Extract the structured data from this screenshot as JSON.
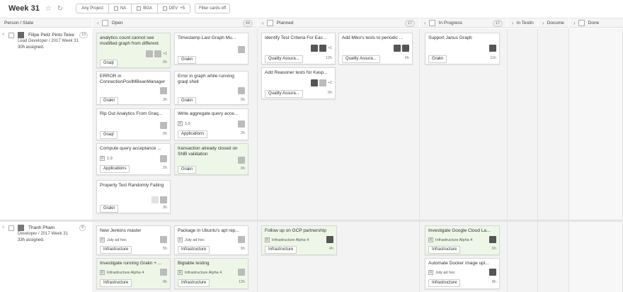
{
  "board": {
    "title": "Week 31",
    "filters": [
      "Any Project",
      "NA",
      "BGA",
      "DEV",
      "+5"
    ],
    "filter_off_label": "Filter cards off"
  },
  "columns": [
    {
      "label": "Person / State",
      "count": ""
    },
    {
      "label": "Open",
      "count": "44"
    },
    {
      "label": "Planned",
      "count": "17"
    },
    {
      "label": "In Progress",
      "count": "17"
    },
    {
      "label": "In Testin",
      "count": ""
    },
    {
      "label": "Docume",
      "count": ""
    },
    {
      "label": "Done",
      "count": ""
    }
  ],
  "people": [
    {
      "name": "Filipe Peliz Pinto Teixe",
      "count": "13",
      "role": "Lead Developer / 2017 Week 31",
      "assigned": "30h assigned."
    },
    {
      "name": "Thanh Pham",
      "count": "8",
      "role": "Developer / 2017 Week 31",
      "assigned": "33h assigned."
    }
  ],
  "cards": {
    "c1": {
      "title": "analytics count cannot see modified graph from different",
      "tag": "Graql",
      "hrs": "0h",
      "extra": "+1"
    },
    "c2": {
      "title": "Timestamp Last Graph Mu...",
      "tag": "Grakn",
      "hrs": "0h"
    },
    "c3": {
      "title": "ERROR in ConnectionPoolMBeanManager",
      "tag": "Grakn",
      "hrs": "3h"
    },
    "c4": {
      "title": "Error in graph while running graql shell",
      "tag": "Grakn",
      "hrs": "0h"
    },
    "c5": {
      "title": "Rip Out Analytics From Graq...",
      "tag": "Graql",
      "hrs": "0h"
    },
    "c6": {
      "title": "Write aggregate query acce...",
      "sub": "1.0",
      "tag": "Applications",
      "hrs": "2h"
    },
    "c7": {
      "title": "Compute query acceptance ...",
      "sub": "1.0",
      "tag": "Applications",
      "hrs": "2h"
    },
    "c8": {
      "title": "transaction already closed on SNB validation",
      "tag": "Grakn",
      "hrs": "0h"
    },
    "c9": {
      "title": "Property Test Randomly Failing",
      "tag": "Grakn",
      "hrs": "3h"
    },
    "c10": {
      "title": "Identify Test Criteria For Eac...",
      "tag": "Quality Assura...",
      "hrs": "12h",
      "extra": "+1"
    },
    "c11": {
      "title": "Add Miko's tests to periodic ...",
      "tag": "Quality Assura...",
      "hrs": "6h"
    },
    "c12": {
      "title": "Add Reasoner tests for Kasp...",
      "tag": "Quality Assura...",
      "hrs": "0h",
      "extra": "+1"
    },
    "c13": {
      "title": "Support Janus Graph",
      "tag": "Grakn",
      "hrs": "11h"
    },
    "d1": {
      "title": "New Jenkins master",
      "sub": "July ad hoc",
      "tag": "Infrastructure",
      "hrs": "5h"
    },
    "d2": {
      "title": "Package in Ubuntu's apt rep...",
      "sub": "July ad hoc",
      "tag": "Infrastructure",
      "hrs": "9h"
    },
    "d3": {
      "title": "Follow up on GCP partnership",
      "sub": "Infrastructure Alpha 4",
      "tag": "Infrastructure",
      "hrs": "4h"
    },
    "d4": {
      "title": "Investigate Google Cloud La...",
      "sub": "Infrastructure Alpha 4",
      "tag": "Infrastructure",
      "hrs": "6h"
    },
    "d5": {
      "title": "Investigate running Grakn + ...",
      "sub": "Infrastructure Alpha 4",
      "tag": "Infrastructure",
      "hrs": "9h"
    },
    "d6": {
      "title": "Bigtable testing",
      "sub": "Infrastructure Alpha 4",
      "tag": "Infrastructure",
      "hrs": "12h"
    },
    "d7": {
      "title": "Automate Docker image upl...",
      "sub": "July ad hoc",
      "tag": "Infrastructure",
      "hrs": "8h"
    }
  },
  "colors": {
    "green_card": "#eef6e8",
    "column_bg": "#f3f3f3"
  }
}
